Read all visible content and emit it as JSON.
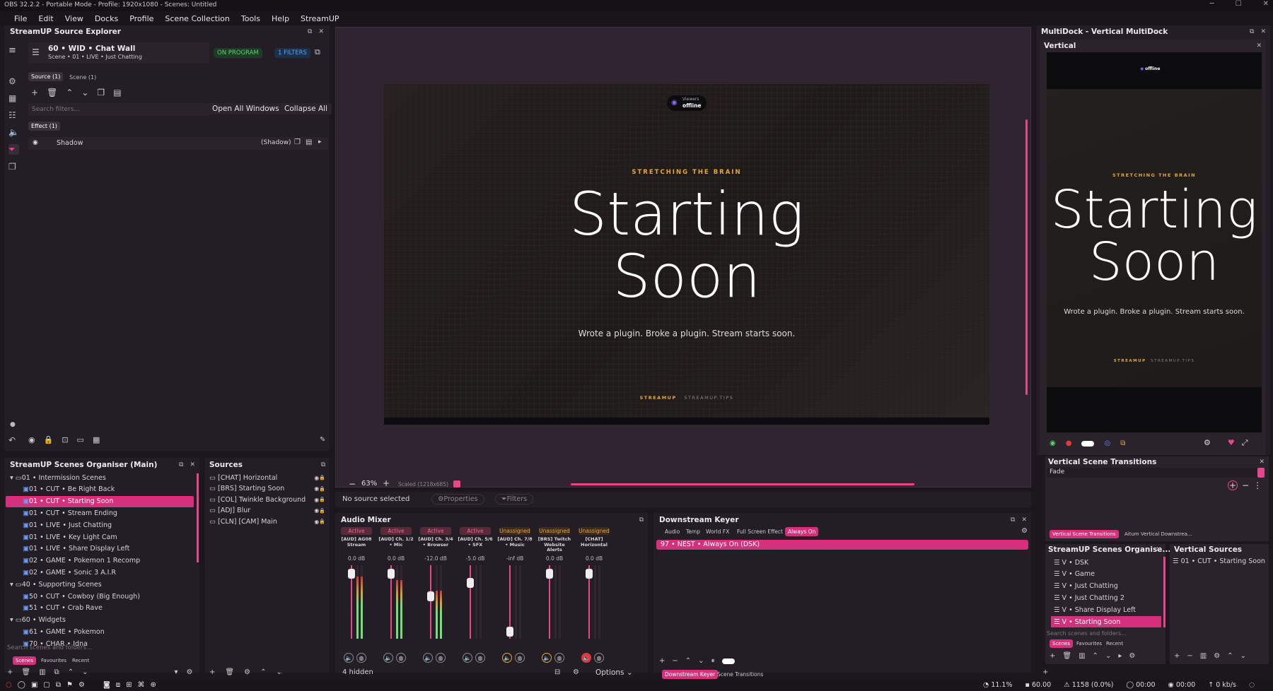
{
  "window": {
    "title": "OBS 32.2.2 - Portable Mode - Profile: 1920x1080 - Scenes: Untitled",
    "min": "─",
    "max": "☐",
    "close": "✕"
  },
  "menu": [
    "File",
    "Edit",
    "View",
    "Docks",
    "Profile",
    "Scene Collection",
    "Tools",
    "Help",
    "StreamUP"
  ],
  "source_explorer": {
    "title": "StreamUP Source Explorer",
    "source_name": "60 • WID • Chat Wall",
    "source_sub": "Scene  •  01 • LIVE • Just Chatting",
    "on_program": "ON PROGRAM",
    "filters_badge": "1 FILTERS",
    "tabs": [
      "Source (1)",
      "Scene (1)"
    ],
    "search_placeholder": "Search filters...",
    "open_all": "Open All Windows",
    "collapse_all": "Collapse All",
    "effect_tab": "Effect (1)",
    "filter_name": "Shadow",
    "filter_tag": "(Shadow)"
  },
  "preview": {
    "viewers_label": "Viewers",
    "viewers_status": "offline",
    "kicker": "STRETCHING THE BRAIN",
    "line1": "Starting",
    "line2": "Soon",
    "tagline": "Wrote a plugin. Broke a plugin. Stream starts soon.",
    "brand1": "STREAMUP",
    "brand2": "STREAMUP.TIPS",
    "zoom": "63%",
    "scaled": "Scaled (1218x685)"
  },
  "source_bar": {
    "no_source": "No source selected",
    "properties": "Properties",
    "filters": "Filters"
  },
  "multidock": {
    "title": "MultiDock - Vertical MultiDock",
    "vertical": "Vertical"
  },
  "vertical_transitions": {
    "title": "Vertical Scene Transitions",
    "value": "Fade",
    "tab1": "Vertical Scene Transitions",
    "tab2": "Aitum Vertical Downstrea..."
  },
  "scenes_organiser": {
    "title": "StreamUP Scenes Organiser (Main)",
    "items": [
      {
        "label": "01 • Intermission Scenes",
        "folder": true
      },
      {
        "label": "01 • CUT • Be Right Back"
      },
      {
        "label": "01 • CUT • Starting Soon",
        "selected": true
      },
      {
        "label": "01 • CUT • Stream Ending"
      },
      {
        "label": "01 • LIVE • Just Chatting"
      },
      {
        "label": "01 • LIVE • Key Light Cam"
      },
      {
        "label": "01 • LIVE • Share Display Left"
      },
      {
        "label": "02 • GAME • Pokemon 1 Recomp"
      },
      {
        "label": "02 • GAME • Sonic 3 A.I.R"
      },
      {
        "label": "40 • Supporting Scenes",
        "folder": true
      },
      {
        "label": "50 • CUT • Cowboy (Big Enough)"
      },
      {
        "label": "51 • CUT • Crab Rave"
      },
      {
        "label": "60 • Widgets",
        "folder": true
      },
      {
        "label": "61 • GAME • Pokemon"
      },
      {
        "label": "70 • CHAR • Idna"
      }
    ],
    "search_placeholder": "Search scenes and folders...",
    "tabs": [
      "Scenes",
      "Favourites",
      "Recent"
    ]
  },
  "sources": {
    "title": "Sources",
    "items": [
      "[CHAT] Horizontal",
      "[BRS] Starting Soon",
      "[COL] Twinkle Background",
      "[ADJ] Blur",
      "[CLN] [CAM] Main"
    ]
  },
  "audio_mixer": {
    "title": "Audio Mixer",
    "channels": [
      {
        "status": "Active",
        "name": "[AUD] AG08 Stream",
        "db": "0.0 dB",
        "level": 0.85,
        "fader": 0.95
      },
      {
        "status": "Active",
        "name": "[AUD] Ch. 1/2 • Mic",
        "db": "0.0 dB",
        "level": 0.8,
        "fader": 0.95
      },
      {
        "status": "Active",
        "name": "[AUD] Ch. 3/4 • Browser",
        "db": "-12.0 dB",
        "level": 0.65,
        "fader": 0.6
      },
      {
        "status": "Active",
        "name": "[AUD] Ch. 5/6 • SFX",
        "db": "-5.0 dB",
        "level": 0.0,
        "fader": 0.8
      },
      {
        "status": "Unassigned",
        "name": "[AUD] Ch. 7/8 • Music",
        "db": "-inf dB",
        "level": 0.0,
        "fader": 0.05
      },
      {
        "status": "Unassigned",
        "name": "[BRS] Twitch Website Alerts",
        "db": "0.0 dB",
        "level": 0.0,
        "fader": 0.95
      },
      {
        "status": "Unassigned",
        "name": "[CHAT] Horizontal",
        "db": "0.0 dB",
        "level": 0.0,
        "fader": 0.95
      }
    ],
    "hidden": "4 hidden",
    "options": "Options"
  },
  "dsk": {
    "title": "Downstream Keyer",
    "tabs": [
      "Audio",
      "Temp",
      "World FX",
      "Full Screen Effect",
      "Always On"
    ],
    "item": "97 • NEST • Always On (DSK)",
    "bottom_tabs": [
      "Downstream Keyer",
      "Scene Transitions"
    ]
  },
  "v_organiser": {
    "title": "StreamUP Scenes Organise...",
    "items": [
      "V • DSK",
      "V • Game",
      "V • Just Chatting",
      "V • Just Chatting 2",
      "V • Share Display Left",
      "V • Starting Soon"
    ],
    "search_placeholder": "Search scenes and folders...",
    "tabs": [
      "Scenes",
      "Favourites",
      "Recent"
    ]
  },
  "v_sources": {
    "title": "Vertical Sources",
    "item": "01 • CUT • Starting Soon"
  },
  "status": {
    "cpu": "11.1%",
    "fps": "60.00",
    "dropped": "1158 (0.0%)",
    "rec_time": "00:00",
    "stream_time": "00:00",
    "kbps": "0 kb/s"
  }
}
